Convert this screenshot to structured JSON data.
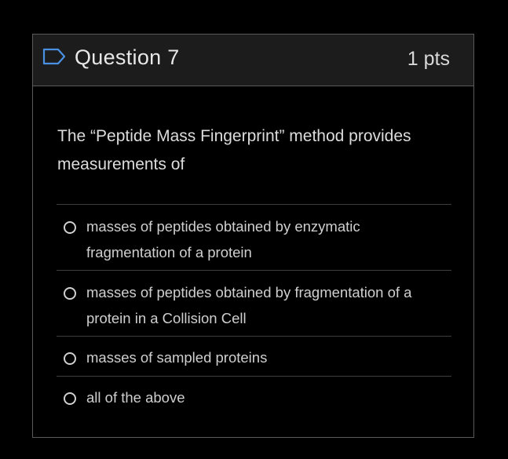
{
  "question": {
    "title": "Question 7",
    "points": "1 pts",
    "flag_icon": "flag-outline-icon",
    "text": "The “Peptide Mass Fingerprint” method provides measurements of"
  },
  "answers": [
    {
      "label": "masses of peptides obtained by enzymatic fragmentation of a protein",
      "selected": false
    },
    {
      "label": "masses of peptides obtained by fragmentation of a protein in a Collision Cell",
      "selected": false
    },
    {
      "label": "masses of sampled proteins",
      "selected": false
    },
    {
      "label": "all of the above",
      "selected": false
    }
  ],
  "colors": {
    "background": "#000000",
    "header_background": "#1c1c1c",
    "border": "#5a5a5a",
    "text": "#dcdcdc",
    "accent": "#4a90e2"
  }
}
